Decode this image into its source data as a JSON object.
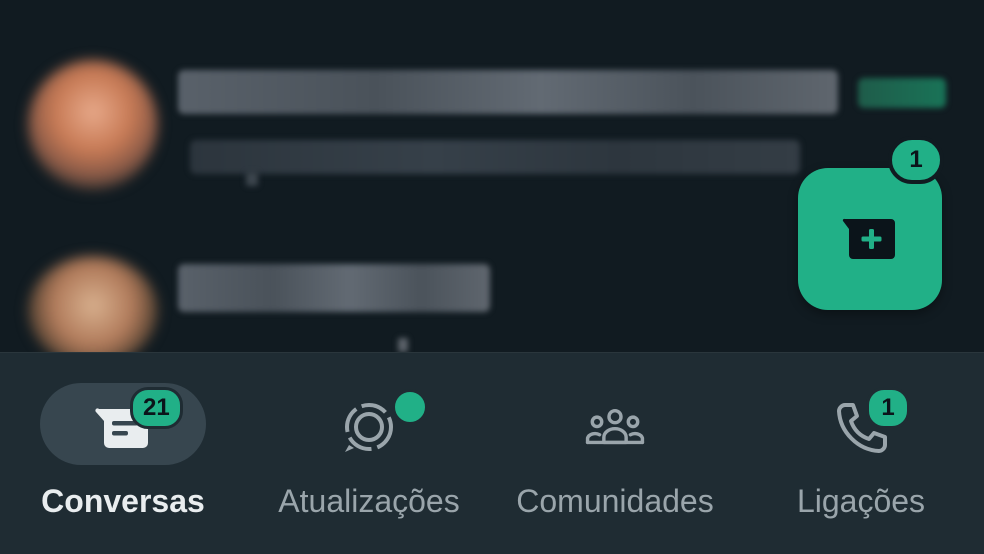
{
  "fab": {
    "icon": "new-chat-icon",
    "badge": "1",
    "color": "#21b087"
  },
  "nav": {
    "items": [
      {
        "label": "Conversas",
        "icon": "chats-icon",
        "badge": "21",
        "active": true
      },
      {
        "label": "Atualizações",
        "icon": "status-icon",
        "dot": true,
        "active": false
      },
      {
        "label": "Comunidades",
        "icon": "communities-icon",
        "active": false
      },
      {
        "label": "Ligações",
        "icon": "phone-icon",
        "badge": "1",
        "active": false
      }
    ]
  },
  "colors": {
    "accent": "#21b087",
    "background": "#111b21",
    "nav_background": "#1f2c33",
    "active_pill": "#37464f",
    "inactive_text": "#9aa5ab",
    "active_text": "#e9edef"
  }
}
